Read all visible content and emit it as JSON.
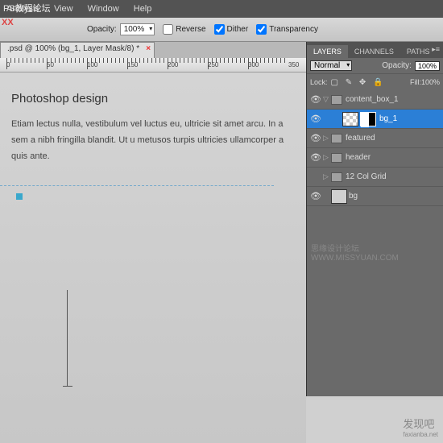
{
  "menu": {
    "items": [
      "Analysis",
      "View",
      "Window",
      "Help"
    ]
  },
  "watermarks": {
    "tl": "PS教程论坛",
    "mid": "思缘设计论坛 WWW.MISSYUAN.COM",
    "br": "发现吧",
    "br2": "faxianba.net",
    "xx": "XX"
  },
  "optbar": {
    "opacity_label": "Opacity:",
    "opacity_value": "100%",
    "reverse": "Reverse",
    "dither": "Dither",
    "transparency": "Transparency"
  },
  "doctab": {
    "title": ".psd @ 100% (bg_1, Layer Mask/8) *"
  },
  "ruler": {
    "marks": [
      "0",
      "50",
      "100",
      "150",
      "200",
      "250",
      "300",
      "350"
    ]
  },
  "canvas": {
    "heading": "Photoshop design",
    "body": "Etiam lectus nulla, vestibulum vel luctus eu, ultricie sit amet arcu. In a sem a nibh fringilla blandit. Ut u metusos turpis ultricies ullamcorper a quis ante."
  },
  "panel": {
    "tabs": [
      "LAYERS",
      "CHANNELS",
      "PATHS"
    ],
    "blend": "Normal",
    "opacity_label": "Opacity:",
    "opacity": "100%",
    "lock": "Lock:",
    "lock_icons": "▢ ✎ ✥ 🔒",
    "fill_label": "Fill:",
    "fill": "100%",
    "layers": [
      {
        "eye": "👁",
        "type": "folder",
        "open": true,
        "name": "content_box_1",
        "sel": false
      },
      {
        "eye": "👁",
        "type": "layer",
        "indent": true,
        "name": "bg_1",
        "sel": true,
        "mask": true,
        "checker": true
      },
      {
        "eye": "👁",
        "type": "folder",
        "name": "featured",
        "sel": false
      },
      {
        "eye": "👁",
        "type": "folder",
        "name": "header",
        "sel": false
      },
      {
        "eye": "",
        "type": "folder",
        "name": "12 Col Grid",
        "sel": false
      },
      {
        "eye": "👁",
        "type": "bg",
        "name": "bg",
        "sel": false
      }
    ]
  }
}
